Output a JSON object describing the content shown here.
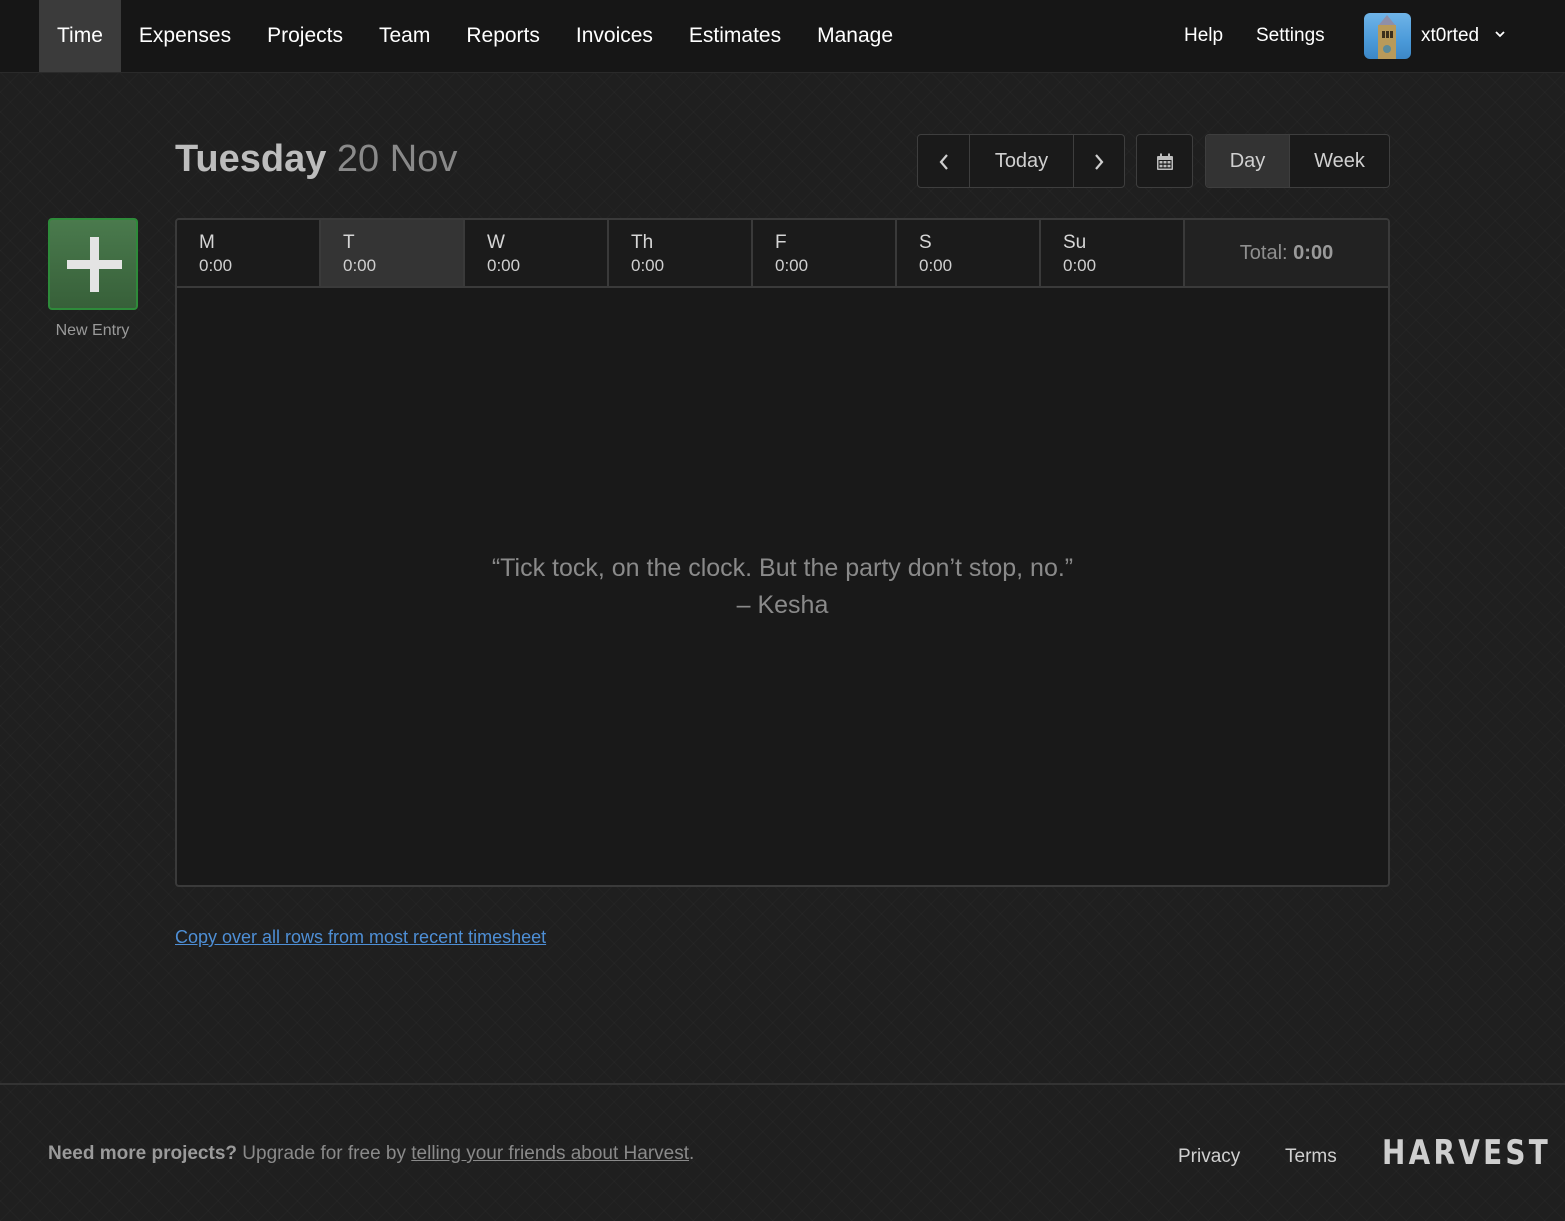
{
  "nav": {
    "items": [
      {
        "label": "Time",
        "active": true
      },
      {
        "label": "Expenses",
        "active": false
      },
      {
        "label": "Projects",
        "active": false
      },
      {
        "label": "Team",
        "active": false
      },
      {
        "label": "Reports",
        "active": false
      },
      {
        "label": "Invoices",
        "active": false
      },
      {
        "label": "Estimates",
        "active": false
      },
      {
        "label": "Manage",
        "active": false
      }
    ],
    "help": "Help",
    "settings": "Settings",
    "user": {
      "name": "xt0rted",
      "avatar": "clock-tower-avatar"
    }
  },
  "header": {
    "weekday": "Tuesday",
    "date": "20 Nov",
    "today_label": "Today",
    "prev_icon": "chevron-left-icon",
    "next_icon": "chevron-right-icon",
    "calendar_icon": "calendar-icon",
    "views": [
      {
        "label": "Day",
        "selected": true
      },
      {
        "label": "Week",
        "selected": false
      }
    ]
  },
  "new_entry": {
    "label": "New Entry",
    "icon": "plus-icon",
    "color": "#2e8b3a"
  },
  "week": {
    "days": [
      {
        "label": "M",
        "time": "0:00",
        "current": false
      },
      {
        "label": "T",
        "time": "0:00",
        "current": true
      },
      {
        "label": "W",
        "time": "0:00",
        "current": false
      },
      {
        "label": "Th",
        "time": "0:00",
        "current": false
      },
      {
        "label": "F",
        "time": "0:00",
        "current": false
      },
      {
        "label": "S",
        "time": "0:00",
        "current": false
      },
      {
        "label": "Su",
        "time": "0:00",
        "current": false
      }
    ],
    "total_label": "Total:",
    "total_value": "0:00"
  },
  "empty_state": {
    "quote": "“Tick tock, on the clock. But the party don’t stop, no.”",
    "author": "– Kesha"
  },
  "copy_link": "Copy over all rows from most recent timesheet",
  "footer": {
    "bold": "Need more projects?",
    "text": " Upgrade for free by ",
    "link": "telling your friends about Harvest",
    "end": ".",
    "privacy": "Privacy",
    "terms": "Terms",
    "logo": "HARVEST"
  },
  "colors": {
    "accent_link": "#4e8fd6",
    "new_entry_green": "#3f6e42"
  }
}
